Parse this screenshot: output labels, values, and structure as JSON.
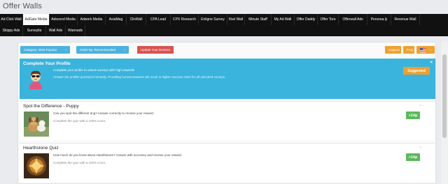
{
  "page": {
    "title": "Offer Walls"
  },
  "tabs_row1": [
    "Ad Click Wall",
    "AdGate Media",
    "Adscend Media",
    "Adwork Media",
    "AsiaMag",
    "ClixWall",
    "CPA Lead",
    "CPX Research",
    "Enligne Survey",
    "Kiwi Wall",
    "Minute Staff",
    "My Ad Wall",
    "Offer Daddy",
    "Offer Toro",
    "Offerwall Ads",
    "Persona.ly",
    "Revenue Wall"
  ],
  "tabs_row2": [
    "Skippy Ads",
    "Surveylla",
    "Wall Ads",
    "Wannads"
  ],
  "active_tab": "AdGate Media",
  "toolbar": {
    "category_label": "Category: Most Popular",
    "order_label": "Order By: Recommended",
    "update_label": "Update Your Devices",
    "support_label": "Support",
    "faq_label": "FAQ",
    "chevron": "›",
    "colors": {
      "blue": "#4bb2de",
      "red": "#d9534f",
      "orange": "#f0a030",
      "green": "#5cb85c"
    }
  },
  "profile_card": {
    "title": "Complete Your Profile",
    "desc": "Complete your profile to unlock surveys with high rewards!",
    "sub": "Answer the profiler questions honestly. Providing honest answers will result in higher success rates for all unlocked surveys.",
    "badge": "Suggested",
    "close": "×"
  },
  "offers": [
    {
      "title": "Spot the Difference - Puppy",
      "desc": "Can you spot the different dog? Answer correctly to receive your reward.",
      "sub": "Complete the quiz with a 100% score.",
      "reward": "+14p",
      "close": "×"
    },
    {
      "title": "Hearthstone Quiz",
      "desc": "How much do you know about Hearthstone? Answer with accuracy and receive your reward.",
      "sub": "Complete the quiz with a 100% score.",
      "reward": "+14p",
      "close": "×"
    }
  ]
}
